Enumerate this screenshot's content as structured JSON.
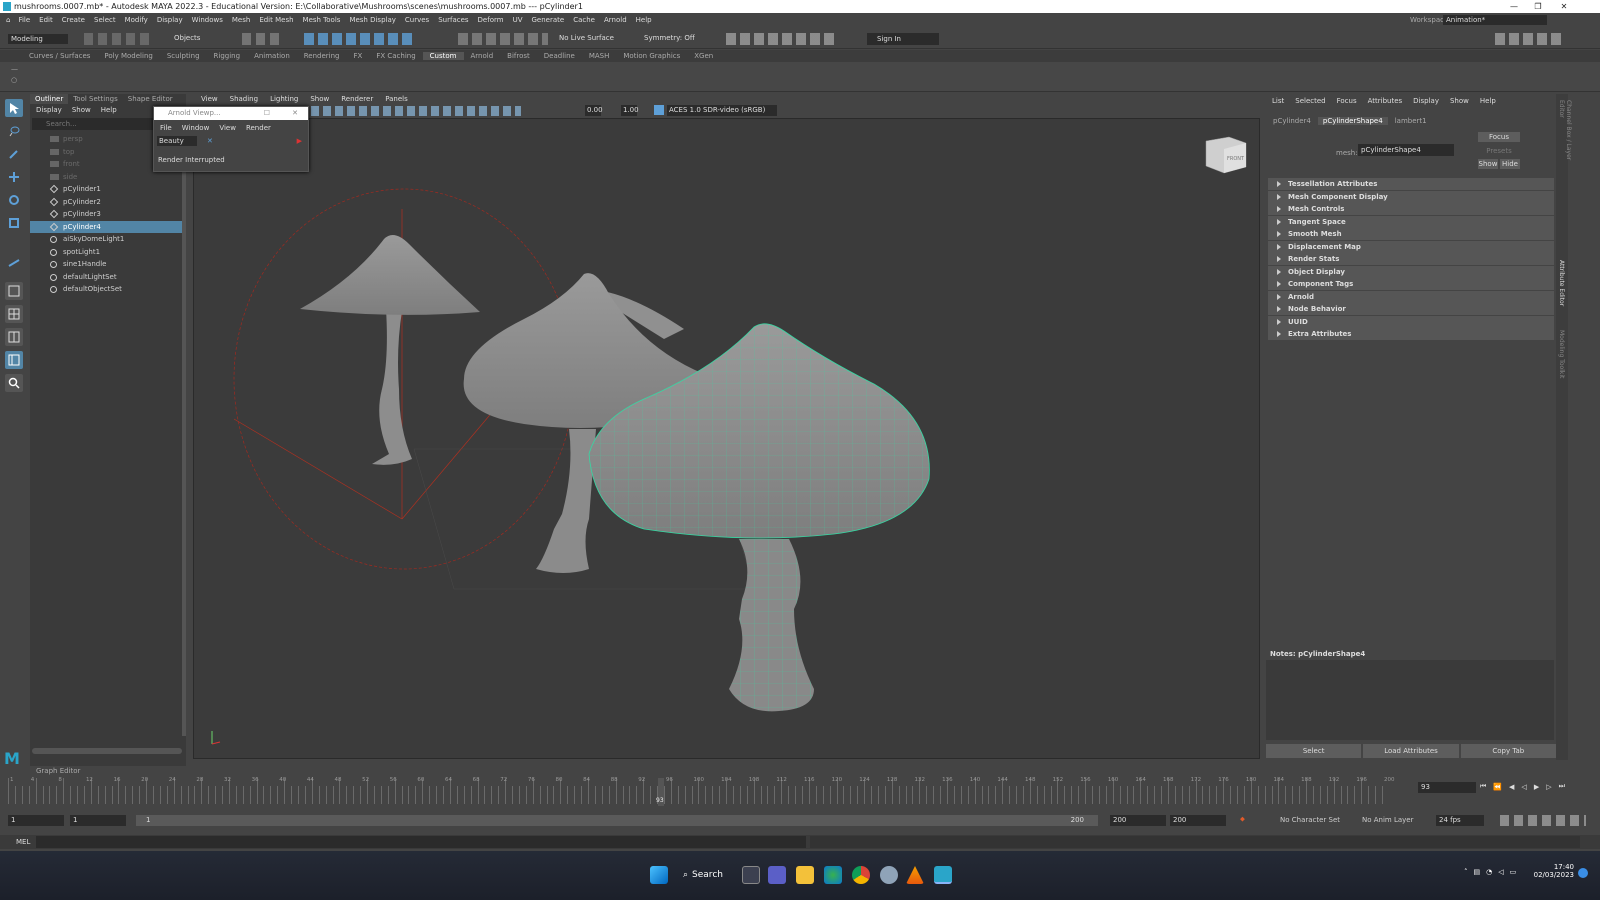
{
  "window": {
    "title": "mushrooms.0007.mb* - Autodesk MAYA 2022.3 - Educational Version: E:\\Collaborative\\Mushrooms\\scenes\\mushrooms.0007.mb  ---  pCylinder1"
  },
  "menus": [
    "File",
    "Edit",
    "Create",
    "Select",
    "Modify",
    "Display",
    "Windows",
    "Mesh",
    "Edit Mesh",
    "Mesh Tools",
    "Mesh Display",
    "Curves",
    "Surfaces",
    "Deform",
    "UV",
    "Generate",
    "Cache",
    "Arnold",
    "Help"
  ],
  "workspace": {
    "label": "Workspace :",
    "value": "Animation*"
  },
  "statusline": {
    "mode": "Modeling",
    "objects": "Objects",
    "live": "No Live Surface",
    "symmetry": "Symmetry: Off",
    "signin": "Sign In"
  },
  "shelf_tabs": [
    "Curves / Surfaces",
    "Poly Modeling",
    "Sculpting",
    "Rigging",
    "Animation",
    "Rendering",
    "FX",
    "FX Caching",
    "Custom",
    "Arnold",
    "Bifrost",
    "Deadline",
    "MASH",
    "Motion Graphics",
    "XGen"
  ],
  "active_shelf": "Custom",
  "outliner": {
    "tabs": [
      "Outliner",
      "Tool Settings",
      "Shape Editor"
    ],
    "menu": [
      "Display",
      "Show",
      "Help"
    ],
    "search_placeholder": "Search...",
    "items": [
      {
        "label": "persp",
        "dim": true
      },
      {
        "label": "top",
        "dim": true
      },
      {
        "label": "front",
        "dim": true
      },
      {
        "label": "side",
        "dim": true
      },
      {
        "label": "pCylinder1",
        "dim": false
      },
      {
        "label": "pCylinder2",
        "dim": false
      },
      {
        "label": "pCylinder3",
        "dim": false
      },
      {
        "label": "pCylinder4",
        "dim": false,
        "selected": true
      },
      {
        "label": "aiSkyDomeLight1",
        "dim": false
      },
      {
        "label": "spotLight1",
        "dim": false
      },
      {
        "label": "sine1Handle",
        "dim": false
      },
      {
        "label": "defaultLightSet",
        "dim": false
      },
      {
        "label": "defaultObjectSet",
        "dim": false
      }
    ]
  },
  "viewport": {
    "menu": [
      "View",
      "Shading",
      "Lighting",
      "Show",
      "Renderer",
      "Panels"
    ],
    "exposure": "0.00",
    "gamma": "1.00",
    "colorspace": "ACES 1.0 SDR-video (sRGB)",
    "viewcube": "FRONT"
  },
  "arnold_viewer": {
    "title": "Arnold Viewp...",
    "menu": [
      "File",
      "Window",
      "View",
      "Render"
    ],
    "aov": "Beauty",
    "status": "Render Interrupted"
  },
  "attribute_editor": {
    "menu": [
      "List",
      "Selected",
      "Focus",
      "Attributes",
      "Display",
      "Show",
      "Help"
    ],
    "tabs": [
      "pCylinder4",
      "pCylinderShape4",
      "lambert1"
    ],
    "active_tab": "pCylinderShape4",
    "mesh_label": "mesh:",
    "mesh_value": "pCylinderShape4",
    "focus": "Focus",
    "presets": "Presets",
    "show": "Show",
    "hide": "Hide",
    "sections": [
      "Tessellation Attributes",
      "Mesh Component Display",
      "Mesh Controls",
      "Tangent Space",
      "Smooth Mesh",
      "Displacement Map",
      "Render Stats",
      "Object Display",
      "Component Tags",
      "Arnold",
      "Node Behavior",
      "UUID",
      "Extra Attributes"
    ],
    "notes": "Notes: pCylinderShape4",
    "buttons": [
      "Select",
      "Load Attributes",
      "Copy Tab"
    ]
  },
  "side_tabs": [
    "Channel Box / Layer Editor",
    "Attribute Editor",
    "Modeling Toolkit"
  ],
  "graph_editor": "Graph Editor",
  "timeline": {
    "ticks": [
      "1",
      "4",
      "8",
      "12",
      "16",
      "20",
      "24",
      "28",
      "32",
      "36",
      "40",
      "44",
      "48",
      "52",
      "56",
      "60",
      "64",
      "68",
      "72",
      "76",
      "80",
      "84",
      "88",
      "92",
      "96",
      "100",
      "104",
      "108",
      "112",
      "116",
      "120",
      "124",
      "128",
      "132",
      "136",
      "140",
      "144",
      "148",
      "152",
      "156",
      "160",
      "164",
      "168",
      "172",
      "176",
      "180",
      "184",
      "188",
      "192",
      "196",
      "200"
    ],
    "current": "93",
    "current_field": "93"
  },
  "range": {
    "start": "1",
    "start2": "1",
    "slider_start": "1",
    "slider_end": "200",
    "end": "200",
    "end2": "200",
    "char_set": "No Character Set",
    "anim_layer": "No Anim Layer",
    "fps": "24 fps"
  },
  "mel": "MEL",
  "taskbar": {
    "search": "Search",
    "time": "17:40",
    "date": "02/03/2023"
  }
}
